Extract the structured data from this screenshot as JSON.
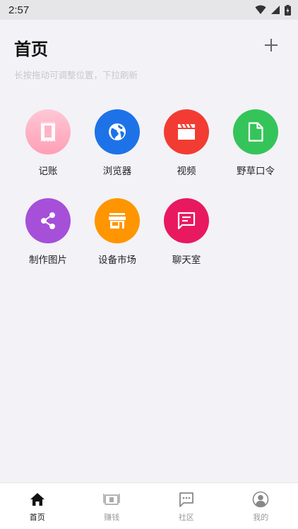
{
  "status_bar": {
    "time": "2:57"
  },
  "header": {
    "title": "首页",
    "hint": "长按拖动可调整位置，下拉刷新"
  },
  "tiles": [
    {
      "label": "记账",
      "color": "#ffb3c6",
      "icon": "receipt-icon"
    },
    {
      "label": "浏览器",
      "color": "#1e72e8",
      "icon": "globe-icon"
    },
    {
      "label": "视频",
      "color": "#f23c33",
      "icon": "clapperboard-icon"
    },
    {
      "label": "野草口令",
      "color": "#35c45a",
      "icon": "document-icon"
    },
    {
      "label": "制作图片",
      "color": "#a64fd9",
      "icon": "share-icon"
    },
    {
      "label": "设备市场",
      "color": "#ff9500",
      "icon": "store-icon"
    },
    {
      "label": "聊天室",
      "color": "#e8195f",
      "icon": "chat-icon"
    }
  ],
  "bottom_nav": {
    "items": [
      {
        "label": "首页",
        "icon": "home-icon",
        "active": true
      },
      {
        "label": "赚钱",
        "icon": "money-icon",
        "active": false
      },
      {
        "label": "社区",
        "icon": "community-icon",
        "active": false
      },
      {
        "label": "我的",
        "icon": "profile-icon",
        "active": false
      }
    ]
  }
}
